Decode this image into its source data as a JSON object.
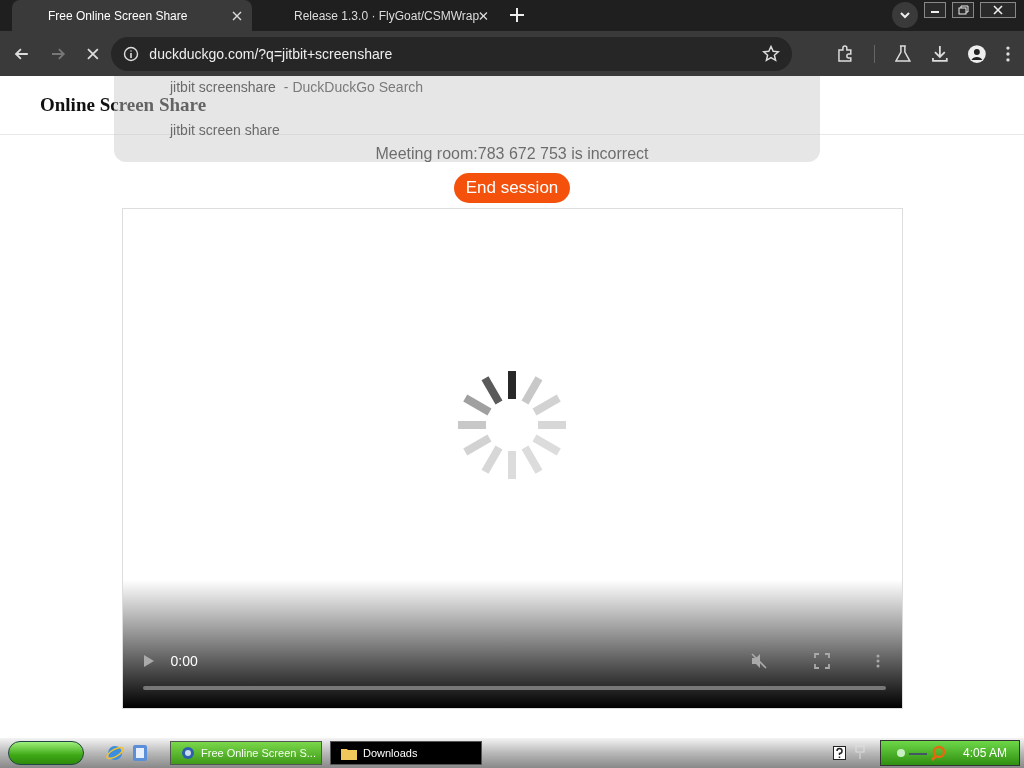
{
  "browser": {
    "tabs": [
      {
        "title": "Free Online Screen Share",
        "selected": true
      },
      {
        "title": "Release 1.3.0 · FlyGoat/CSMWrap",
        "selected": false
      }
    ],
    "address": "duckduckgo.com/?q=jitbit+screenshare",
    "suggestions": [
      {
        "text": "jitbit screenshare",
        "detail": "- DuckDuckGo Search"
      },
      {
        "text": "jitbit screen share"
      }
    ]
  },
  "page": {
    "site_title": "Online Screen Share",
    "message": "Meeting room:783 672 753 is incorrect",
    "end_button": "End session",
    "video": {
      "time": "0:00"
    }
  },
  "taskbar": {
    "windows": [
      {
        "label": "Free Online Screen S...",
        "selected": true,
        "kind": "browser"
      },
      {
        "label": "Downloads",
        "selected": false,
        "kind": "folder"
      }
    ],
    "clock": "4:05 AM"
  }
}
